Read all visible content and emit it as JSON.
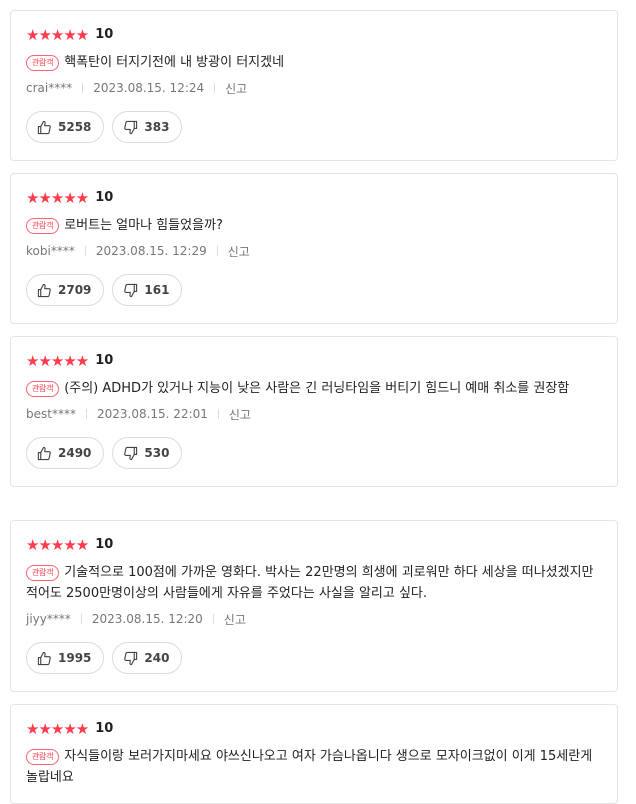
{
  "reviews": [
    {
      "stars": "★★★★★",
      "score": "10",
      "badge": "관람객",
      "text": "핵폭탄이 터지기전에 내 방광이 터지겠네",
      "user": "crai****",
      "date": "2023.08.15. 12:24",
      "report": "신고",
      "likes": "5258",
      "dislikes": "383"
    },
    {
      "stars": "★★★★★",
      "score": "10",
      "badge": "관람객",
      "text": "로버트는 얼마나 힘들었을까?",
      "user": "kobi****",
      "date": "2023.08.15. 12:29",
      "report": "신고",
      "likes": "2709",
      "dislikes": "161"
    },
    {
      "stars": "★★★★★",
      "score": "10",
      "badge": "관람객",
      "text": "(주의) ADHD가 있거나 지능이 낮은 사람은 긴 러닝타임을 버티기 힘드니 예매 취소를 권장함",
      "user": "best****",
      "date": "2023.08.15. 22:01",
      "report": "신고",
      "likes": "2490",
      "dislikes": "530"
    },
    {
      "stars": "★★★★★",
      "score": "10",
      "badge": "관람객",
      "text": "기술적으로 100점에 가까운 영화다. 박사는 22만명의 희생에 괴로워만 하다 세상을 떠나셨겠지만 적어도 2500만명이상의 사람들에게 자유를 주었다는 사실을 알리고 싶다.",
      "user": "jiyy****",
      "date": "2023.08.15. 12:20",
      "report": "신고",
      "likes": "1995",
      "dislikes": "240"
    },
    {
      "stars": "★★★★★",
      "score": "10",
      "badge": "관람객",
      "text": "자식들이랑 보러가지마세요 야쓰신나오고 여자 가슴나옵니다 생으로 모자이크없이 이게 15세란게 놀랍네요",
      "user": "",
      "date": "",
      "report": "",
      "likes": "",
      "dislikes": ""
    }
  ],
  "colors": {
    "star": "#ff3c4b",
    "border": "#e4e4e4",
    "meta": "#777777"
  },
  "icons": {
    "like": "thumbs-up-icon",
    "dislike": "thumbs-down-icon"
  }
}
